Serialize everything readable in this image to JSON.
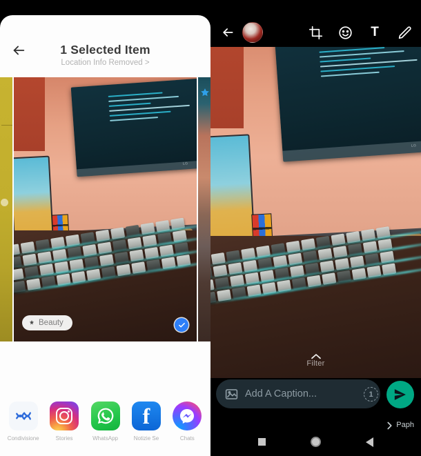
{
  "left_panel": {
    "name": "android-share-sheet",
    "back_icon": "back-arrow-icon",
    "title": "1 Selected Item",
    "subtitle": "Location Info Removed >",
    "photo": {
      "beauty_chip_label": "Beauty",
      "beauty_chip_icon": "sparkle-icon",
      "selected_icon": "check-circle-icon",
      "star_icon": "star-badge-icon",
      "monitor_logo": "LG"
    },
    "apps": [
      {
        "label": "Condivisione",
        "icon": "nearby-share-icon"
      },
      {
        "label": "Stories",
        "icon": "instagram-icon"
      },
      {
        "label": "WhatsApp",
        "icon": "whatsapp-icon"
      },
      {
        "label": "Notizie Se",
        "icon": "facebook-icon"
      },
      {
        "label": "Chats",
        "icon": "messenger-icon"
      }
    ]
  },
  "right_panel": {
    "name": "whatsapp-media-editor",
    "topbar": {
      "back_icon": "back-arrow-icon",
      "avatar_icon": "avatar",
      "tools": [
        {
          "name": "crop-icon",
          "glyph": "crop"
        },
        {
          "name": "sticker-icon",
          "glyph": "smiley"
        },
        {
          "name": "text-icon",
          "glyph": "T"
        },
        {
          "name": "draw-icon",
          "glyph": "pencil"
        }
      ]
    },
    "filter": {
      "chevron_icon": "chevron-up-icon",
      "label": "Filter"
    },
    "caption": {
      "image_icon": "image-icon",
      "value": "",
      "placeholder": "Add A Caption...",
      "view_once_icon": "view-once-icon",
      "view_once_label": "1",
      "send_icon": "send-icon"
    },
    "recipient": {
      "chevron_icon": "chevron-right-icon",
      "label": "Paph"
    },
    "navbar": [
      {
        "name": "recents-button",
        "icon": "square-icon"
      },
      {
        "name": "home-button",
        "icon": "circle-icon"
      },
      {
        "name": "back-button",
        "icon": "triangle-icon"
      }
    ]
  },
  "colors": {
    "send_green": "#00a884",
    "caption_bg": "#1f2c33",
    "select_blue": "#2d7ff9",
    "star_blue": "#2f9fe8"
  }
}
